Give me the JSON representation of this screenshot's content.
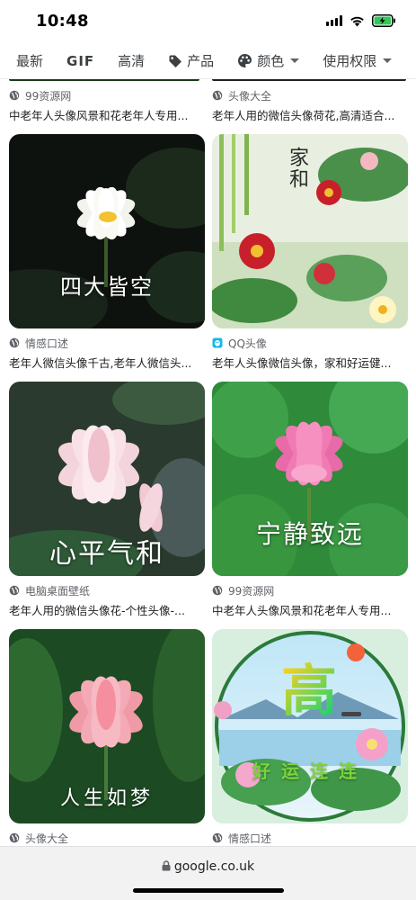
{
  "status_bar": {
    "time": "10:48"
  },
  "filters": [
    {
      "label": "最新"
    },
    {
      "label": "GIF"
    },
    {
      "label": "高清"
    },
    {
      "label": "产品",
      "icon": "tag-icon"
    },
    {
      "label": "颜色",
      "icon": "palette-icon",
      "dropdown": true
    },
    {
      "label": "使用权限",
      "dropdown": true
    }
  ],
  "top_partial": [
    {
      "source": "99资源网",
      "title": "中老年人头像风景和花老年人专用..."
    },
    {
      "source": "头像大全",
      "title": "老年人用的微信头像荷花,高清适合..."
    }
  ],
  "results": [
    {
      "caption": "四大皆空",
      "source": "情感口述",
      "source_icon": "globe-icon",
      "title": "老年人微信头像千古,老年人微信头..."
    },
    {
      "caption": "家和",
      "source": "QQ头像",
      "source_icon": "qq-favicon-icon",
      "title": "老年人头像微信头像，家和好运健..."
    },
    {
      "caption": "心平气和",
      "source": "电脑桌面壁纸",
      "source_icon": "globe-icon",
      "title": "老年人用的微信头像花-个性头像-..."
    },
    {
      "caption": "宁静致远",
      "source": "99资源网",
      "source_icon": "globe-icon",
      "title": "中老年人头像风景和花老年人专用..."
    },
    {
      "caption": "人生如梦",
      "source": "头像大全",
      "source_icon": "globe-icon",
      "title": ""
    },
    {
      "caption": "高",
      "caption2": "好运连连",
      "source": "情感口述",
      "source_icon": "globe-icon",
      "title": ""
    }
  ],
  "url_bar": {
    "url": "google.co.uk"
  },
  "colors": {
    "accent": "#202124",
    "muted": "#5f6368",
    "battery": "#34c759"
  }
}
